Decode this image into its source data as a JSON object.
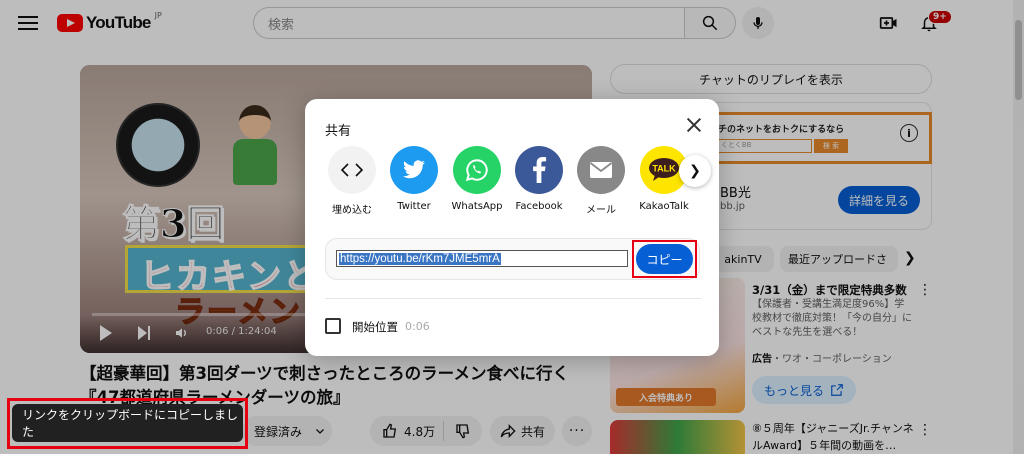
{
  "header": {
    "logo_text": "YouTube",
    "logo_region": "JP",
    "search_placeholder": "検索",
    "notification_count": "9+"
  },
  "video": {
    "thumb_title_line1": "第3回",
    "thumb_title_line2": "ヒカキンと行",
    "thumb_title_line3": "ラーメン",
    "time": "0:06 / 1:24:04",
    "title": "【超豪華回】第3回ダーツで刺さったところのラーメン食べに行く『47都道府県ラーメンダーツの旅』",
    "subscribe_label": "登録済み",
    "like_count": "4.8万",
    "share_label": "共有",
    "more_label": "···"
  },
  "sidebar": {
    "chat_replay_label": "チャットのリプレイを表示",
    "ad": {
      "banner_text": "チのネットをおトクにするなら",
      "search_placeholder": "くとくBB",
      "search_button": "検 索",
      "title": "BB光",
      "url": "bb.jp",
      "detail_button": "詳細を見る"
    },
    "chips": [
      "akinTV",
      "最近アップロードさ"
    ],
    "recommendations": [
      {
        "title": "3/31（金）まで限定特典多数",
        "description": "【保護者・受講生満足度96%】学校教材で徹底対策！「今の自分」にベストな先生を選べる！",
        "ad_label": "広告",
        "advertiser": "・ワオ・コーポレーション",
        "thumb_label": "入会特典あり",
        "more_button": "もっと見る"
      },
      {
        "title": "⑧５周年【ジャニーズJr.チャンネルAward】５年間の動画を…"
      }
    ]
  },
  "share_dialog": {
    "title": "共有",
    "targets": [
      {
        "label": "埋め込む",
        "icon": "embed-icon",
        "color": "#f2f2f2"
      },
      {
        "label": "Twitter",
        "icon": "twitter-icon",
        "color": "#1d9bf0"
      },
      {
        "label": "WhatsApp",
        "icon": "whatsapp-icon",
        "color": "#25d366"
      },
      {
        "label": "Facebook",
        "icon": "facebook-icon",
        "color": "#3b5998"
      },
      {
        "label": "メール",
        "icon": "mail-icon",
        "color": "#888888"
      },
      {
        "label": "KakaoTalk",
        "icon": "kakaotalk-icon",
        "color": "#fee500"
      }
    ],
    "link": "https://youtu.be/rKm7JME5mrA",
    "copy_button": "コピー",
    "start_at_label": "開始位置",
    "start_at_time": "0:06"
  },
  "toast": {
    "message": "リンクをクリップボードにコピーしました"
  }
}
